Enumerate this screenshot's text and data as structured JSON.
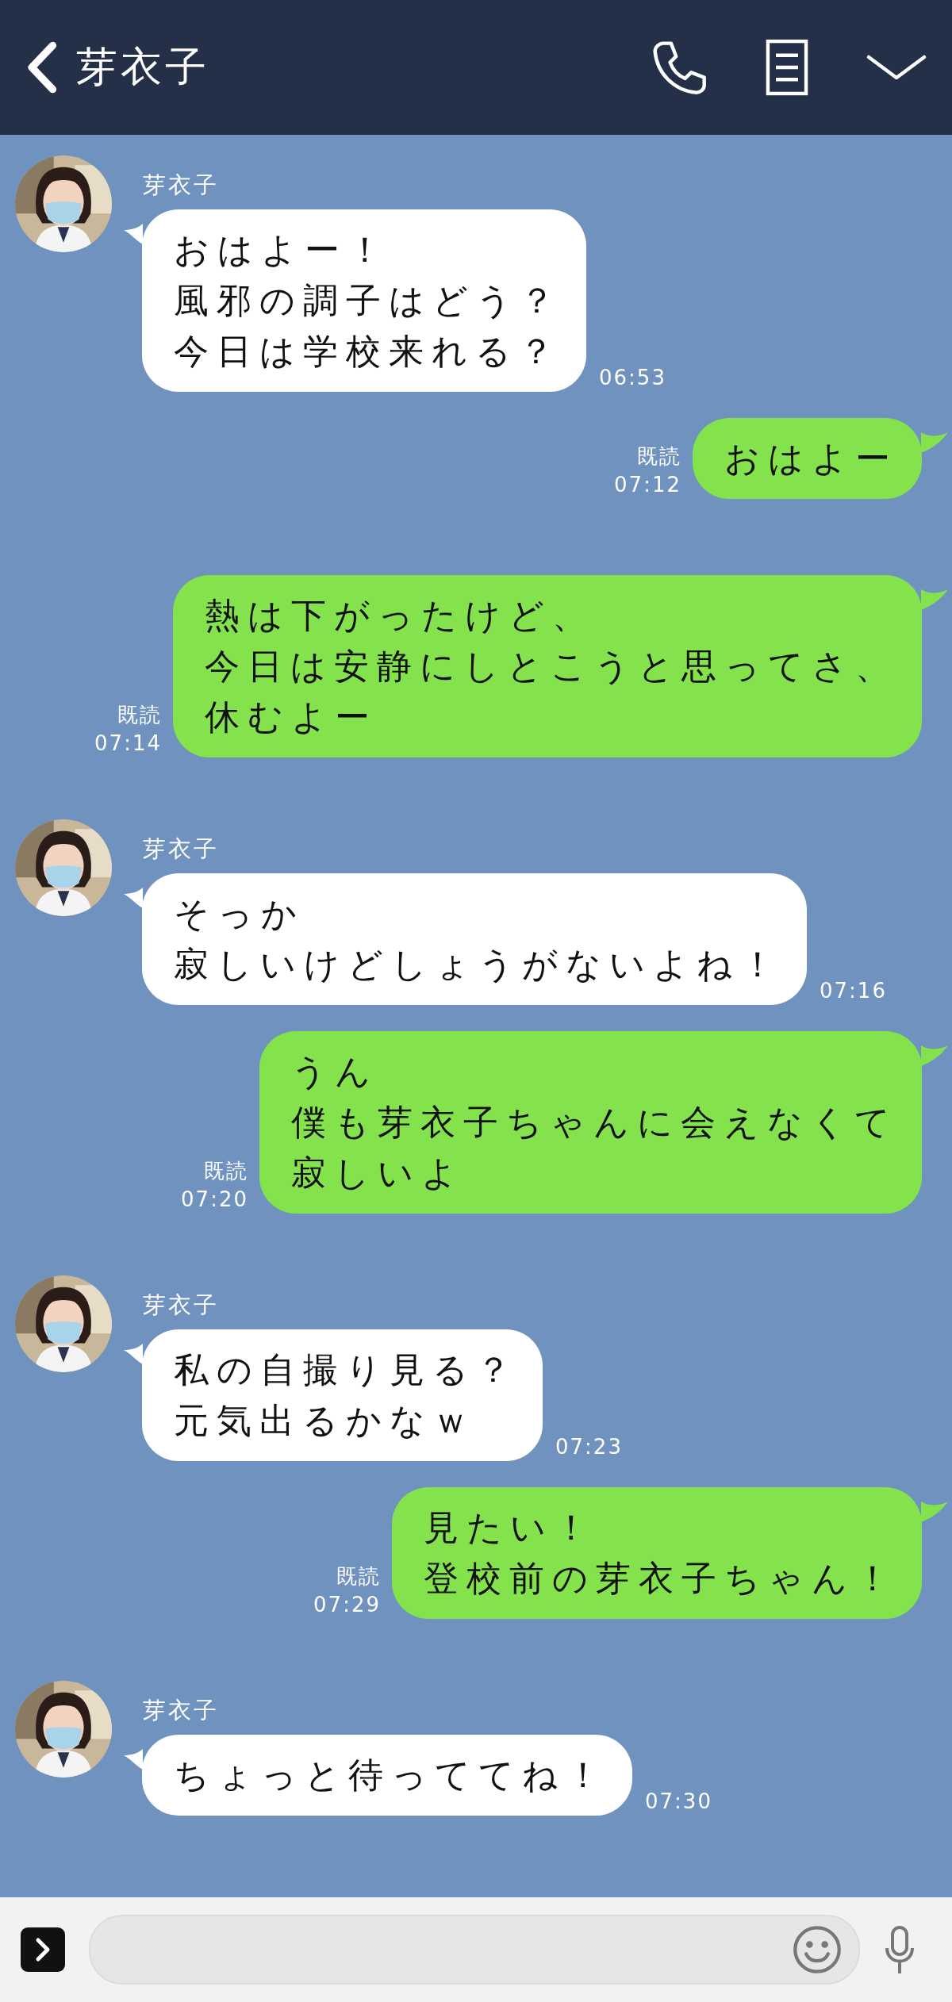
{
  "header": {
    "title": "芽衣子"
  },
  "messages": [
    {
      "kind": "in",
      "sender": "芽衣子",
      "lines": [
        "おはよー！",
        "風邪の調子はどう？",
        "今日は学校来れる？"
      ],
      "time": "06:53"
    },
    {
      "kind": "out",
      "read": "既読",
      "lines": [
        "おはよー"
      ],
      "time": "07:12"
    },
    {
      "kind": "out",
      "read": "既読",
      "lines": [
        "熱は下がったけど、",
        "今日は安静にしとこうと思ってさ、",
        "休むよー"
      ],
      "time": "07:14"
    },
    {
      "kind": "in",
      "sender": "芽衣子",
      "lines": [
        "そっか",
        "寂しいけどしょうがないよね！"
      ],
      "time": "07:16"
    },
    {
      "kind": "out",
      "read": "既読",
      "lines": [
        "うん",
        "僕も芽衣子ちゃんに会えなくて",
        "寂しいよ"
      ],
      "time": "07:20"
    },
    {
      "kind": "in",
      "sender": "芽衣子",
      "lines": [
        "私の自撮り見る？",
        "元気出るかなｗ"
      ],
      "time": "07:23"
    },
    {
      "kind": "out",
      "read": "既読",
      "lines": [
        "見たい！",
        "登校前の芽衣子ちゃん！"
      ],
      "time": "07:29"
    },
    {
      "kind": "in",
      "sender": "芽衣子",
      "lines": [
        "ちょっと待っててね！"
      ],
      "time": "07:30"
    }
  ]
}
